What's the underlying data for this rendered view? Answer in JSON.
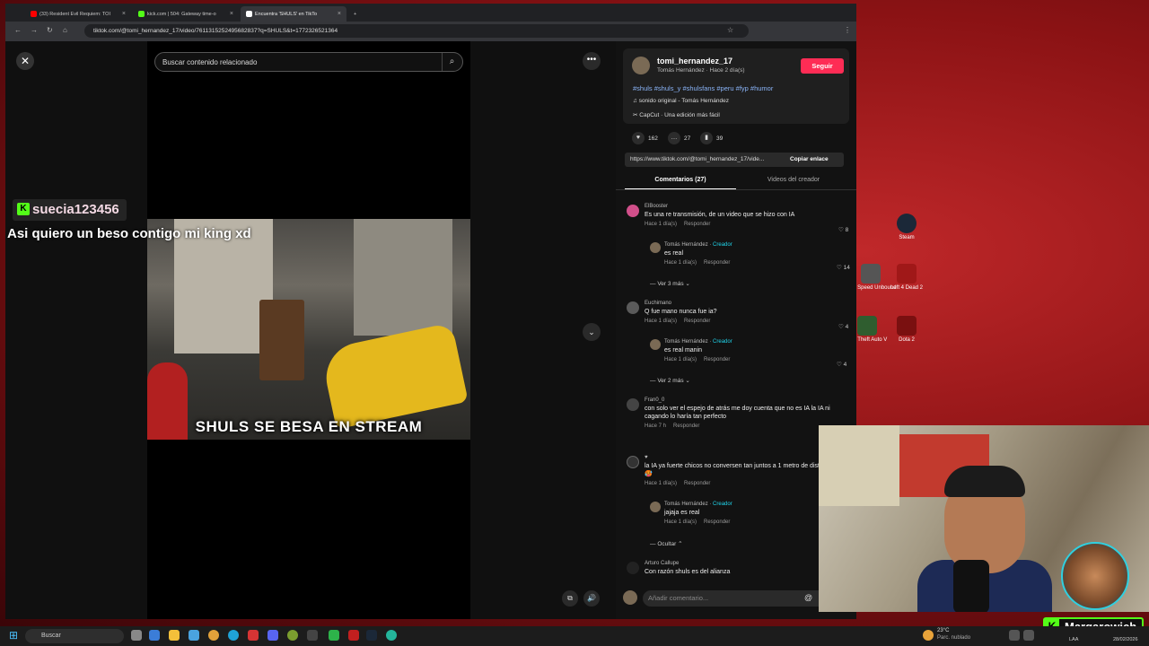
{
  "browser": {
    "tabs": [
      {
        "label": "(33) Resident Evil Requiem: TOI",
        "color": "#ff0000"
      },
      {
        "label": "kick.com | 504: Gateway time-o",
        "color": "#53fc18"
      },
      {
        "label": "Encuentra 'SHULS' en TikTo",
        "color": "#ffffff"
      }
    ],
    "url": "tiktok.com/@tomi_hernandez_17/video/7611315252495682837?q=SHULS&t=1772326521364"
  },
  "video": {
    "search_placeholder": "Buscar contenido relacionado",
    "caption": "SHULS SE BESA EN STREAM"
  },
  "creator": {
    "username": "tomi_hernandez_17",
    "subline": "Tomás Hernández · Hace 2 día(s)",
    "follow_label": "Seguir",
    "hashtags": "#shuls #shuls_y #shulsfans #peru #fyp #humor",
    "sound": "sonido original - Tomás Hernández",
    "capcut": "CapCut · Una edición más fácil"
  },
  "stats": {
    "likes": "162",
    "comments": "27",
    "saves": "39"
  },
  "link": {
    "url": "https://www.tiktok.com/@tomi_hernandez_17/vide...",
    "copy_label": "Copiar enlace"
  },
  "panel_tabs": {
    "comments": "Comentarios (27)",
    "creator_videos": "Videos del creador"
  },
  "comments": [
    {
      "user": "ElBooster",
      "text": "Es una re transmisión, de un video que se hizo con IA",
      "time": "Hace 1 día(s)",
      "reply": "Responder",
      "likes": "8"
    },
    {
      "user": "Tomás Hernández",
      "tag": "Creador",
      "text": "es real",
      "time": "Hace 1 día(s)",
      "reply": "Responder",
      "likes": "14"
    },
    {
      "more": "Ver 3 más"
    },
    {
      "user": "Euchimano",
      "text": "Q fue mano nunca fue ia?",
      "time": "Hace 1 día(s)",
      "reply": "Responder",
      "likes": "4"
    },
    {
      "user": "Tomás Hernández",
      "tag": "Creador",
      "text": "es real manin",
      "time": "Hace 1 día(s)",
      "reply": "Responder",
      "likes": "4"
    },
    {
      "more": "Ver 2 más"
    },
    {
      "user": "Fran0_0",
      "text": "con solo ver el espejo de atrás me doy cuenta que no es IA la IA ni cagando lo haría tan perfecto",
      "time": "Hace 7 h",
      "reply": "Responder"
    },
    {
      "user": "♥",
      "text": "la IA ya fuerte chicos no conversen tan juntos a 1 metro de distancia 🥵",
      "time": "Hace 1 día(s)",
      "reply": "Responder"
    },
    {
      "user": "Tomás Hernández",
      "tag": "Creador",
      "text": "jajaja es real",
      "time": "Hace 1 día(s)",
      "reply": "Responder"
    },
    {
      "more": "Ocultar"
    },
    {
      "user": "Arturo Callupe",
      "text": "Con razón shuls es del alianza"
    }
  ],
  "add_comment_placeholder": "Añadir comentario...",
  "stream_overlay": {
    "chat_user": "suecia123456",
    "chat_message": "Asi quiero un beso contigo mi king xd",
    "brand": "Margarowich"
  },
  "desktop_icons": [
    {
      "label": "Steam"
    },
    {
      "label": "d for Speed Unbound"
    },
    {
      "label": "Left 4 Dead 2"
    },
    {
      "label": "and Theft Auto V"
    },
    {
      "label": "Dota 2"
    }
  ],
  "taskbar": {
    "search_label": "Buscar",
    "weather_temp": "23°C",
    "weather_desc": "Parc. nublado",
    "lang": "LAA",
    "date": "28/02/2026"
  }
}
